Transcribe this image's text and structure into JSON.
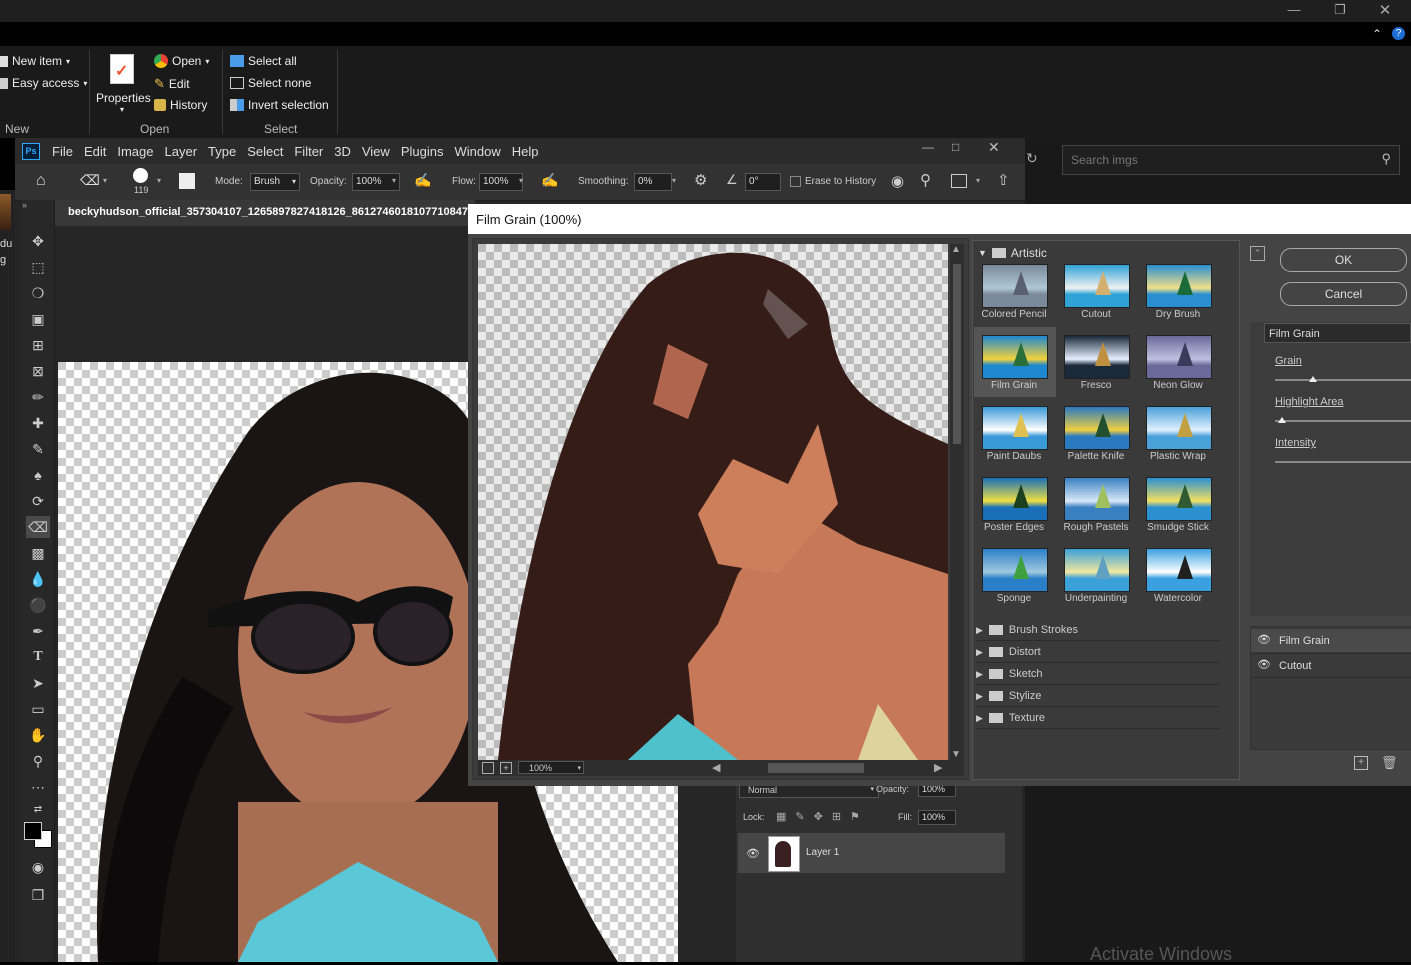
{
  "explorer": {
    "ribbon": {
      "new_item": "New item",
      "easy_access": "Easy access",
      "new_group": "New",
      "properties": "Properties",
      "open": "Open",
      "edit": "Edit",
      "history": "History",
      "open_group": "Open",
      "select_all": "Select all",
      "select_none": "Select none",
      "invert_selection": "Invert selection",
      "select_group": "Select"
    },
    "search_placeholder": "Search imgs",
    "watermark": "Activate Windows"
  },
  "photoshop": {
    "logo": "Ps",
    "menu": [
      "File",
      "Edit",
      "Image",
      "Layer",
      "Type",
      "Select",
      "Filter",
      "3D",
      "View",
      "Plugins",
      "Window",
      "Help"
    ],
    "options": {
      "brush_size": "119",
      "mode_label": "Mode:",
      "mode_value": "Brush",
      "opacity_label": "Opacity:",
      "opacity_value": "100%",
      "flow_label": "Flow:",
      "flow_value": "100%",
      "smoothing_label": "Smoothing:",
      "smoothing_value": "0%",
      "angle_value": "0°",
      "erase_history": "Erase to History"
    },
    "doc_tab": "beckyhudson_official_357304107_1265897827418126_8612746018107710847",
    "left_strip_text": [
      "du",
      "g"
    ],
    "layers": {
      "blend_mode": "Normal",
      "opacity_label": "Opacity:",
      "opacity_value": "100%",
      "lock_label": "Lock:",
      "fill_label": "Fill:",
      "fill_value": "100%",
      "layer_name": "Layer 1"
    }
  },
  "dialog": {
    "title": "Film Grain (100%)",
    "zoom": "100%",
    "artistic_label": "Artistic",
    "thumbnails": [
      "Colored Pencil",
      "Cutout",
      "Dry Brush",
      "Film Grain",
      "Fresco",
      "Neon Glow",
      "Paint Daubs",
      "Palette Knife",
      "Plastic Wrap",
      "Poster Edges",
      "Rough Pastels",
      "Smudge Stick",
      "Sponge",
      "Underpainting",
      "Watercolor"
    ],
    "categories": [
      "Brush Strokes",
      "Distort",
      "Sketch",
      "Stylize",
      "Texture"
    ],
    "ok": "OK",
    "cancel": "Cancel",
    "filter_select": "Film Grain",
    "grain_label": "Grain",
    "highlight_label": "Highlight Area",
    "intensity_label": "Intensity",
    "grain_level": 0.28,
    "highlight_level": 0.05,
    "effect_layers": [
      "Film Grain",
      "Cutout"
    ],
    "colors": {
      "accent": "#1473e6",
      "ok_border": "#cfcfcf"
    }
  }
}
